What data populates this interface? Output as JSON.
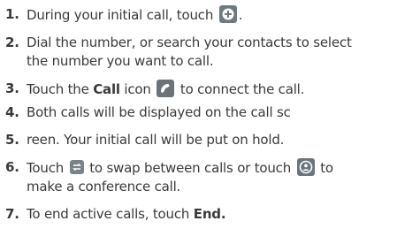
{
  "steps": [
    {
      "num": "1.",
      "text1": "During your initial call, touch",
      "text2": "."
    },
    {
      "num": "2.",
      "line1": "Dial the number, or search your contacts to select",
      "line2": "the number you want to call."
    },
    {
      "num": "3.",
      "pre": "Touch the",
      "bold": "Call",
      "mid": "icon",
      "post": "to connect the call."
    },
    {
      "num": "4.",
      "text": "Both calls will be displayed on the call sc"
    },
    {
      "num": "5.",
      "text": "reen. Your initial call will be put on hold."
    },
    {
      "num": "6.",
      "pre": "Touch",
      "mid": "to swap between calls or touch",
      "post": "to",
      "line2": "make a conference call."
    },
    {
      "num": "7.",
      "pre": "To end active calls, touch",
      "bold": "End."
    }
  ],
  "icons": {
    "add_call": "add-call-icon",
    "call": "call-icon",
    "swap_calls": "swap-calls-icon",
    "merge_calls": "merge-calls-icon"
  }
}
